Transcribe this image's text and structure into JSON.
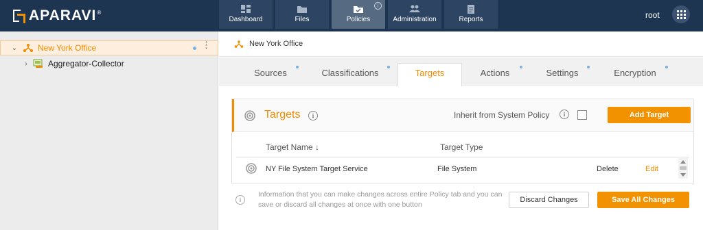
{
  "header": {
    "logo_text": "APARAVI",
    "logo_reg": "®",
    "nav": [
      {
        "label": "Dashboard",
        "icon": "dashboard-icon"
      },
      {
        "label": "Files",
        "icon": "folder-icon"
      },
      {
        "label": "Policies",
        "icon": "policies-icon",
        "active": true,
        "info": "i"
      },
      {
        "label": "Administration",
        "icon": "users-icon"
      },
      {
        "label": "Reports",
        "icon": "clipboard-icon"
      }
    ],
    "user": "root",
    "apps_icon": "apps-grid-icon"
  },
  "sidebar": {
    "items": [
      {
        "label": "New York Office",
        "caret": "⌄",
        "selected": true,
        "icon": "network-icon",
        "menu": "⋮"
      },
      {
        "label": "Aggregator-Collector",
        "caret": "›",
        "icon": "aggregator-icon"
      }
    ]
  },
  "main": {
    "breadcrumb": "New York Office",
    "tabs": [
      {
        "label": "Sources"
      },
      {
        "label": "Classifications"
      },
      {
        "label": "Targets",
        "active": true
      },
      {
        "label": "Actions"
      },
      {
        "label": "Settings"
      },
      {
        "label": "Encryption"
      }
    ],
    "panel": {
      "title": "Targets",
      "inherit_label": "Inherit from System Policy",
      "inherit_checked": false,
      "add_button": "Add Target",
      "columns": [
        "Target Name ↓",
        "Target Type"
      ],
      "rows": [
        {
          "name": "NY File System Target Service",
          "type": "File System",
          "delete": "Delete",
          "edit": "Edit"
        }
      ]
    },
    "footer": {
      "info_text": "Information that you can make changes across entire Policy tab and you can save or discard all changes at once with one button",
      "discard_button": "Discard Changes",
      "save_button": "Save All Changes"
    }
  },
  "colors": {
    "header_bg": "#1e3552",
    "accent": "#f39200",
    "nav_active": "#566a82",
    "link_orange": "#f08c00"
  }
}
